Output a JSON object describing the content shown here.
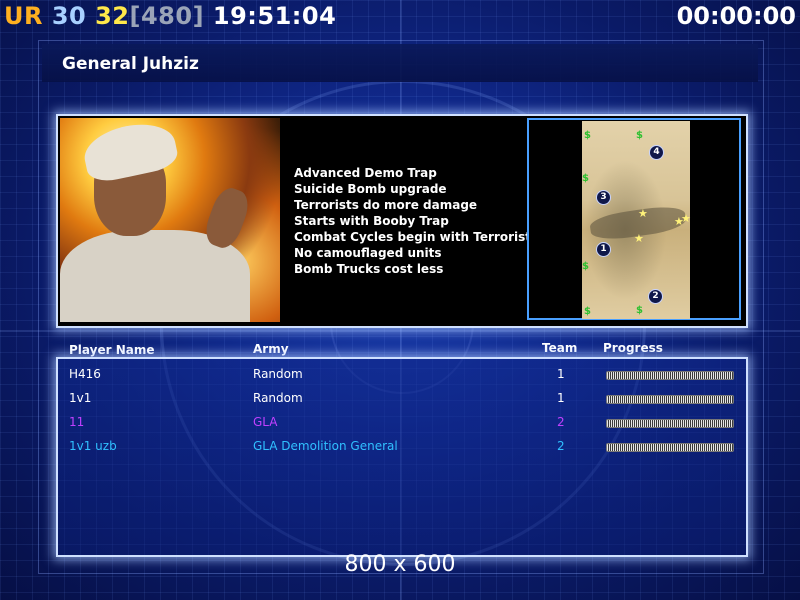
{
  "hud": {
    "prefix": "UR",
    "value_a": "30",
    "value_b": "32",
    "bracket": "[480]",
    "clock": "19:51:04",
    "timer": "00:00:00"
  },
  "title": "General Juhziz",
  "traits": [
    "Advanced Demo Trap",
    "Suicide Bomb upgrade",
    "Terrorists do more damage",
    "Starts with Booby Trap",
    "Combat Cycles begin with Terrorist",
    "No camouflaged units",
    "Bomb Trucks cost less"
  ],
  "map": {
    "start_labels": [
      "1",
      "2",
      "3",
      "4"
    ],
    "money_symbol": "$"
  },
  "table": {
    "headers": {
      "player": "Player Name",
      "army": "Army",
      "team": "Team",
      "progress": "Progress"
    },
    "rows": [
      {
        "player": "H416",
        "army": "Random",
        "team": "1",
        "color": "#ffffff"
      },
      {
        "player": "1v1",
        "army": "Random",
        "team": "1",
        "color": "#ffffff"
      },
      {
        "player": "11",
        "army": "GLA",
        "team": "2",
        "color": "#c040ff"
      },
      {
        "player": "1v1 uzb",
        "army": "GLA Demolition General",
        "team": "2",
        "color": "#30c0ff"
      }
    ]
  },
  "resolution": "800 x 600"
}
